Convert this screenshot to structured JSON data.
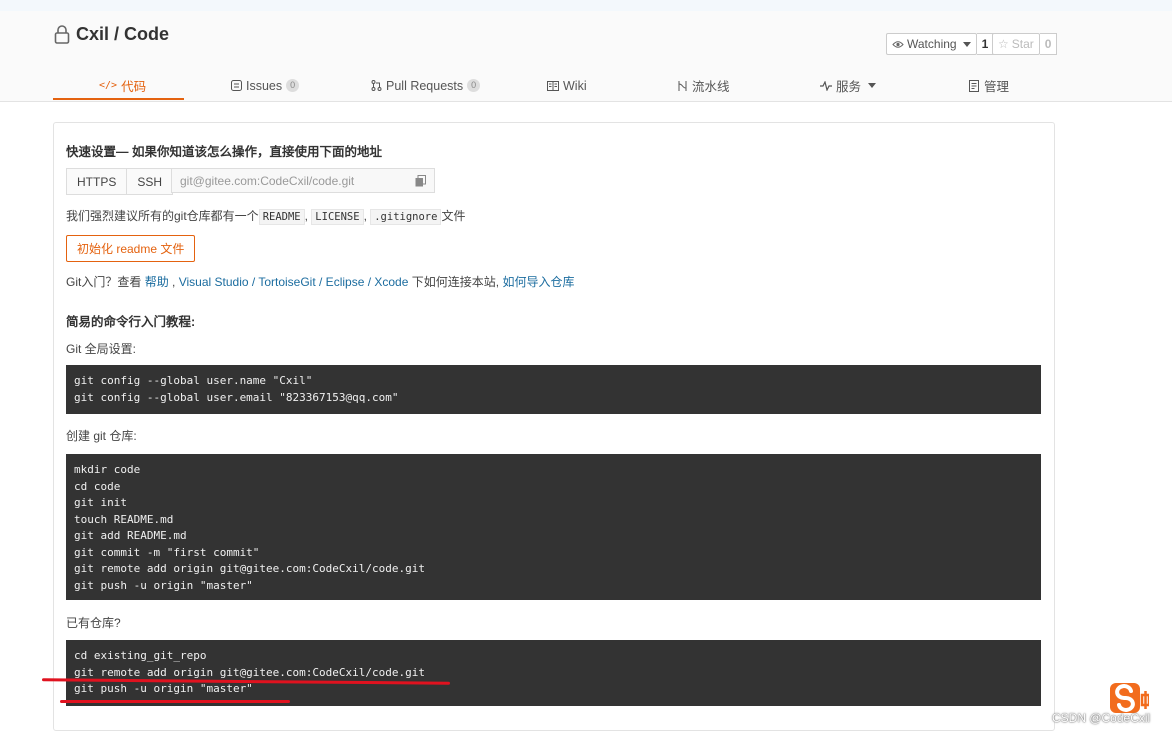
{
  "repo": {
    "owner": "Cxil",
    "separator": "/",
    "name": "Code",
    "title": "Cxil / Code"
  },
  "actions": {
    "watching_label": "Watching",
    "watching_count": "1",
    "star_label": "Star",
    "star_count": "0"
  },
  "tabs": [
    {
      "label": "代码",
      "icon": "code-icon",
      "badge": null
    },
    {
      "label": "Issues",
      "icon": "issues-icon",
      "badge": "0"
    },
    {
      "label": "Pull Requests",
      "icon": "pull-request-icon",
      "badge": "0"
    },
    {
      "label": "Wiki",
      "icon": "wiki-icon",
      "badge": null
    },
    {
      "label": "流水线",
      "icon": "pipeline-icon",
      "badge": null
    },
    {
      "label": "服务",
      "icon": "service-icon",
      "badge": null
    },
    {
      "label": "管理",
      "icon": "manage-icon",
      "badge": null
    }
  ],
  "quick_setup": {
    "heading": "快速设置— 如果你知道该怎么操作，直接使用下面的地址",
    "https_label": "HTTPS",
    "ssh_label": "SSH",
    "url_value": "git@gitee.com:CodeCxil/code.git",
    "recommend_prefix": "我们强烈建议所有的git仓库都有一个",
    "recommend_files": [
      "README",
      "LICENSE",
      ".gitignore"
    ],
    "recommend_suffix": "文件",
    "init_button": "初始化 readme 文件",
    "help_prefix": "Git入门？查看",
    "help_link": "帮助",
    "tools": "Visual Studio / TortoiseGit / Eclipse / Xcode",
    "tools_suffix": "下如何连接本站,",
    "import_link": "如何导入仓库"
  },
  "tutorial": {
    "heading": "简易的命令行入门教程:",
    "global_label": "Git 全局设置:",
    "global_lines": [
      "git config --global user.name \"Cxil\"",
      "git config --global user.email \"823367153@qq.com\""
    ],
    "create_label": "创建 git 仓库:",
    "create_lines": [
      "mkdir code",
      "cd code",
      "git init",
      "touch README.md",
      "git add README.md",
      "git commit -m \"first commit\"",
      "git remote add origin git@gitee.com:CodeCxil/code.git",
      "git push -u origin \"master\""
    ],
    "existing_label": "已有仓库?",
    "existing_lines": [
      "cd existing_git_repo",
      "git remote add origin git@gitee.com:CodeCxil/code.git",
      "git push -u origin \"master\""
    ]
  },
  "watermark": "CSDN @CodeCxil",
  "colors": {
    "accent": "#e4620f",
    "link": "#1b6c9f",
    "code_bg": "#333333",
    "annotation": "#e0121f"
  }
}
